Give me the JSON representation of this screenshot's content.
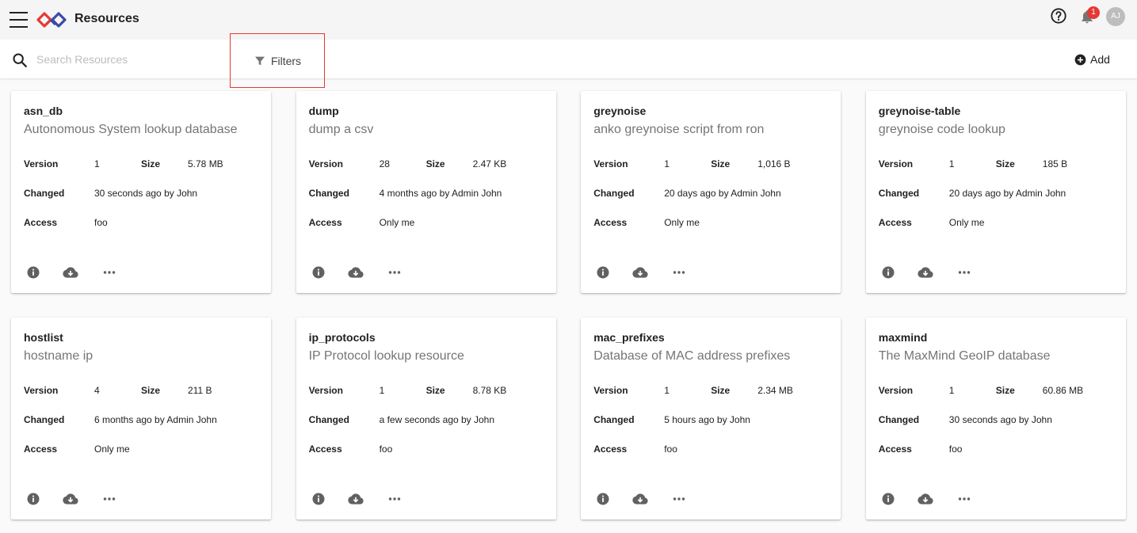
{
  "app": {
    "title": "Resources",
    "notification_count": "1",
    "avatar_initials": "AJ",
    "brand_colors": {
      "left": "#e53935",
      "right": "#3949ab"
    }
  },
  "toolbar": {
    "search_placeholder": "Search Resources",
    "filters_label": "Filters",
    "add_label": "Add"
  },
  "labels": {
    "version": "Version",
    "size": "Size",
    "changed": "Changed",
    "access": "Access"
  },
  "resources": [
    {
      "name": "asn_db",
      "description": "Autonomous System lookup database",
      "version": "1",
      "size": "5.78 MB",
      "changed": "30 seconds ago by John",
      "access": "foo"
    },
    {
      "name": "dump",
      "description": "dump a csv",
      "version": "28",
      "size": "2.47 KB",
      "changed": "4 months ago by Admin John",
      "access": "Only me"
    },
    {
      "name": "greynoise",
      "description": "anko greynoise script from ron",
      "version": "1",
      "size": "1,016 B",
      "changed": "20 days ago by Admin John",
      "access": "Only me"
    },
    {
      "name": "greynoise-table",
      "description": "greynoise code lookup",
      "version": "1",
      "size": "185 B",
      "changed": "20 days ago by Admin John",
      "access": "Only me"
    },
    {
      "name": "hostlist",
      "description": "hostname ip",
      "version": "4",
      "size": "211 B",
      "changed": "6 months ago by Admin John",
      "access": "Only me"
    },
    {
      "name": "ip_protocols",
      "description": "IP Protocol lookup resource",
      "version": "1",
      "size": "8.78 KB",
      "changed": "a few seconds ago by John",
      "access": "foo"
    },
    {
      "name": "mac_prefixes",
      "description": "Database of MAC address prefixes",
      "version": "1",
      "size": "2.34 MB",
      "changed": "5 hours ago by John",
      "access": "foo"
    },
    {
      "name": "maxmind",
      "description": "The MaxMind GeoIP database",
      "version": "1",
      "size": "60.86 MB",
      "changed": "30 seconds ago by John",
      "access": "foo"
    }
  ],
  "card_actions": [
    "info-icon",
    "download-icon",
    "more-icon"
  ]
}
